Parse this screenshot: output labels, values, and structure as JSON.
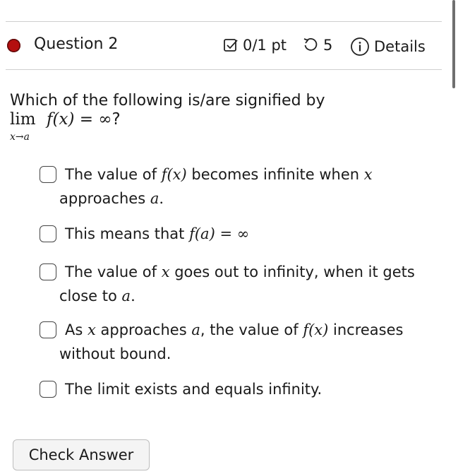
{
  "question": {
    "title": "Question 2",
    "score": "0/1 pt",
    "tries": "5",
    "details": "Details"
  },
  "prompt": {
    "text": "Which of the following is/are signified by",
    "lim_word": "lim",
    "lim_sub": "x→a",
    "lim_expr": "f(x) = ∞",
    "lim_end": "?"
  },
  "choices": [
    {
      "pre": "The value of ",
      "math": "f(x)",
      "post": " becomes infinite when ",
      "math2": "x",
      "line2_pre": "approaches ",
      "line2_math": "a",
      "line2_post": ".",
      "checked": false
    },
    {
      "pre": "This means that ",
      "math": "f(a) = ∞",
      "checked": false
    },
    {
      "pre": "The value of ",
      "math": "x",
      "post": " goes out to infinity, when it gets",
      "line2_pre": "close to ",
      "line2_math": "a",
      "line2_post": ".",
      "checked": false
    },
    {
      "pre": "As ",
      "math": "x",
      "post": " approaches ",
      "math2": "a",
      "post2": ", the value of ",
      "math3": "f(x)",
      "post3": " increases",
      "line2_pre": "without bound.",
      "checked": false
    },
    {
      "pre": "The limit exists and equals infinity.",
      "checked": false
    }
  ],
  "check_button": "Check Answer",
  "colors": {
    "status_dot": "#b40f0f",
    "rule": "#cfcfcf",
    "button_bg": "#f4f4f4"
  },
  "icons": [
    "status-dot-icon",
    "checkbox-score-icon",
    "retry-icon",
    "info-icon"
  ]
}
